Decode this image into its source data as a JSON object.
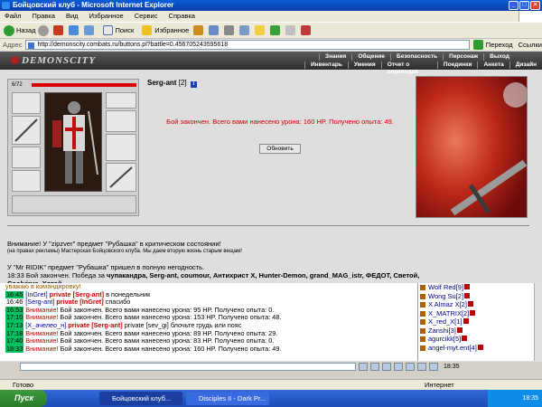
{
  "window": {
    "title": "Бойцовский клуб - Microsoft Internet Explorer"
  },
  "menu": [
    "Файл",
    "Правка",
    "Вид",
    "Избранное",
    "Сервис",
    "Справка"
  ],
  "toolbar": {
    "back": "Назад",
    "search": "Поиск",
    "favorites": "Избранное"
  },
  "address": {
    "label": "Адрес",
    "url": "http://demonscity.combats.ru/buttons.pl?battle=0.456705243595618",
    "go": "Переход",
    "links": "Ссылки"
  },
  "site": {
    "logo": "DEMONSCITY",
    "nav_top": [
      "Знания",
      "Общение",
      "Безопасность",
      "Персонаж",
      "Выход"
    ],
    "nav_bottom": [
      "Инвентарь",
      "Умения",
      "Отчет о переводах",
      "Поединки",
      "Анкета",
      "Дизайн"
    ]
  },
  "character": {
    "hp": "6/72"
  },
  "opponent": {
    "name": "Serg-ant",
    "level": "[2]"
  },
  "battle": {
    "message": "Бой закончен. Всего вами нанесено урона: 160 HP. Получено опыта: 49.",
    "refresh": "Обновить"
  },
  "notices": {
    "warning": "Внимание! У \"zipzver\" предмет \"Рубашка\" в критическом состоянии!",
    "ad": "(на правах рекламы) Мастерская Бойцовского клуба. Мы даем вторую жизнь старым вещам!",
    "broken": "У \"Mr RIDIK\" предмет \"Рубашка\" пришел в полную негодность.",
    "victory_time": "18:33",
    "victory_text": "Бой закончен. Победа за",
    "victory_names": "чупакандра, Serg-ant, coumour, Антихрист X, Hunter-Demon, grand_MAG_istr, ФЕДОТ, Светой, Coolvirus, Хотэй"
  },
  "chat": [
    {
      "time": "",
      "hl": false,
      "nick": "",
      "private": "",
      "text": "уважаю в командировку!"
    },
    {
      "time": "16:45",
      "hl": true,
      "nick": "[InGret]",
      "private": "private [Serg-ant]",
      "text": "в понедельник"
    },
    {
      "time": "16:46",
      "hl": false,
      "nick": "[Serg-ant]",
      "private": "private [InGret]",
      "text": "спасибо"
    },
    {
      "time": "16:53",
      "hl": true,
      "nick": "",
      "private": "",
      "warn": "Внимание!",
      "text": "Бой закончен. Всего вами нанесено урона: 95 HP. Получено опыта: 0."
    },
    {
      "time": "17:10",
      "hl": true,
      "nick": "",
      "private": "",
      "warn": "Внимание!",
      "text": "Бой закончен. Всего вами нанесено урона: 153 HP. Получено опыта: 48."
    },
    {
      "time": "17:13",
      "hl": true,
      "nick": "[X_ачелео_н]",
      "private": "private [Serg-ant]",
      "text": "private [sev_gi] блочьте грудь или пояс"
    },
    {
      "time": "17:18",
      "hl": true,
      "nick": "",
      "private": "",
      "warn": "Внимание!",
      "text": "Бой закончен. Всего вами нанесено урона: 89 HP. Получено опыта: 29."
    },
    {
      "time": "17:40",
      "hl": true,
      "nick": "",
      "private": "",
      "warn": "Внимание!",
      "text": "Бой закончен. Всего вами нанесено урона: 83 HP. Получено опыта: 0."
    },
    {
      "time": "18:33",
      "hl": true,
      "nick": "",
      "private": "",
      "warn": "Внимание!",
      "text": "Бой закончен. Всего вами нанесено урона: 160 HP. Получено опыта: 49."
    }
  ],
  "users": [
    "Wolf Red[9]",
    "Wong Su[2]",
    "X Almaz X[2]",
    "X_MATRIX[2]",
    "X_red_X[1]",
    "Zanshi[3]",
    "agurcikk[5]",
    "angel-myt.ent[4]"
  ],
  "clock": "18:35",
  "status": {
    "text": "Готово",
    "zone": "Интернет"
  },
  "taskbar": {
    "start": "Пуск",
    "tasks": [
      "Бойцовский клуб...",
      "Disciples II - Dark Pr..."
    ],
    "time": "18:35"
  }
}
